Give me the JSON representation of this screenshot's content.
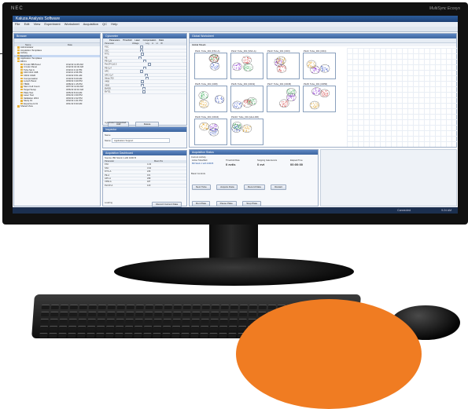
{
  "monitor": {
    "brand": "NEC",
    "model": "MultiSync Ecosys"
  },
  "app": {
    "window_title": "Kaluza Analysis Software",
    "menu": [
      "File",
      "Edit",
      "View",
      "Experiment",
      "Worksheet",
      "Acquisition",
      "QC",
      "Help"
    ]
  },
  "browser_panel": {
    "title": "Browser",
    "columns": [
      "Name",
      "Date"
    ],
    "items": [
      {
        "label": "Administrator",
        "date": ""
      },
      {
        "label": "Acquisition Templates",
        "date": ""
      },
      {
        "label": "Activity",
        "date": ""
      },
      {
        "label": "Experiment",
        "date": ""
      },
      {
        "label": "Application Templates",
        "date": ""
      },
      {
        "label": "DB 01",
        "date": ""
      },
      {
        "label": "8 Color BB Panel",
        "date": "3/12/13 11:45 AM"
      },
      {
        "label": "4 Color Panel",
        "date": "3/12/13 10:32 AM"
      },
      {
        "label": "Tube Set A",
        "date": "3/11/13 4:12 PM"
      },
      {
        "label": "CD3 CD4 CD8",
        "date": "3/11/13 2:06 PM"
      },
      {
        "label": "CD19 CD20",
        "date": "3/10/13 9:51 AM"
      },
      {
        "label": "Compensation",
        "date": "3/10/13 9:20 AM"
      },
      {
        "label": "Lymph Panel",
        "date": "3/09/13 3:40 PM"
      },
      {
        "label": "TBNK",
        "date": "3/08/13 1:15 PM"
      },
      {
        "label": "Stem Cell Count",
        "date": "3/07/13 11:02 AM"
      },
      {
        "label": "Target Setup",
        "date": "3/06/13 10:10 AM"
      },
      {
        "label": "Plate Test",
        "date": "3/05/13 8:44 AM"
      },
      {
        "label": "Laser Test",
        "date": "3/04/13 4:30 PM"
      },
      {
        "label": "Validation 2013",
        "date": "3/03/13 2:22 PM"
      },
      {
        "label": "Study 01",
        "date": "3/02/13 1:01 PM"
      },
      {
        "label": "Experiment 01",
        "date": "3/01/13 9:33 AM"
      },
      {
        "label": "Shared View",
        "date": ""
      }
    ]
  },
  "cytometer_panel": {
    "title": "Cytometer",
    "tabs": [
      "Parameters",
      "Threshold",
      "Laser",
      "Compensation",
      "Ratio"
    ],
    "columns": [
      "Parameter",
      "",
      "Voltage",
      "Log",
      "A",
      "H",
      "W"
    ],
    "rows": [
      "FSC",
      "SSC",
      "FITC",
      "PE",
      "PE-Cy5",
      "PerCP-Cy5.5",
      "PE-Cy7",
      "APC",
      "APC-Cy7",
      "Alexa 700",
      "V450",
      "V500",
      "BV605",
      "BV711"
    ],
    "buttons": [
      "Add",
      "Delete"
    ],
    "connected_label": "Cytometer Connected"
  },
  "inspector_panel": {
    "title": "Inspector",
    "name_label": "Name",
    "name_value": "Application Support"
  },
  "acquisition_panel": {
    "title": "Acquisition Dashboard",
    "source_label": "Source",
    "source_value": "BD Stock 1 with 1000 B",
    "columns": [
      "Parameter",
      "",
      "Mean Pre"
    ],
    "rows": [
      {
        "name": "FSC",
        "value": "4.43"
      },
      {
        "name": "SSC",
        "value": "3.94"
      },
      {
        "name": "FITC-A",
        "value": "246"
      },
      {
        "name": "PE-A",
        "value": "101"
      },
      {
        "name": "APC-A",
        "value": "298"
      },
      {
        "name": "V450-A",
        "value": "187"
      },
      {
        "name": "PerCP-A",
        "value": "120"
      }
    ],
    "button": "Record Current Data",
    "status": "Loading"
  },
  "worksheet": {
    "title": "Global Worksheet",
    "tab": "Global Sheet1",
    "plots": [
      "Plot1: Tube_001 (FSC-A)",
      "Plot2: Tube_001 (SSC-A)",
      "Plot3: Tube_001 (CD3)",
      "Plot4: Tube_001 (CD4)",
      "Plot5: Tube_001 (CD8)",
      "Plot6: Tube_001 (CD19)",
      "Plot7: Tube_001 (CD45)",
      "Plot8: Tube_001 (CD56)",
      "Plot9: Tube_001 (CD16)",
      "Plot10: Tube_001 (HLA-DR)"
    ]
  },
  "acq_status": {
    "title": "Acquisition Status",
    "current_activity_label": "Current Activity",
    "active_tube_label": "Active Tube/Well",
    "active_tube_value": "BD Stock 1 with 1000 B",
    "threshold_label": "Threshold Rate",
    "threshold_value": "0 evt/s",
    "stopping_label": "Stopping Gate Events",
    "stopping_value": "0 evt",
    "elapsed_label": "Elapsed Time",
    "elapsed_value": "00:00:00",
    "basic_controls_label": "Basic Controls",
    "buttons_row1": [
      "Next Tube",
      "Acquire Data",
      "Record Data",
      "Restart"
    ],
    "buttons_row2": [
      "Run Plate",
      "Pause Plate",
      "Stop Plate"
    ]
  },
  "taskbar": {
    "status": "Connected",
    "time": "9:24 AM"
  },
  "colors": {
    "accent_orange": "#f07c22",
    "window_blue": "#3d669f",
    "monitor_black": "#111111"
  }
}
